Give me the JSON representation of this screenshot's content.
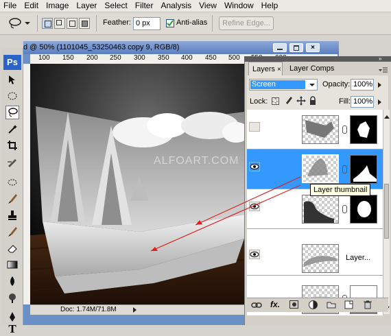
{
  "menu": [
    "File",
    "Edit",
    "Image",
    "Layer",
    "Select",
    "Filter",
    "Analysis",
    "View",
    "Window",
    "Help"
  ],
  "options": {
    "feather_label": "Feather:",
    "feather_value": "0 px",
    "antialias_label": "Anti-alias",
    "refine_edge_label": "Refine Edge..."
  },
  "document": {
    "title": "d @ 50% (1101045_53250463 copy 9, RGB/8)",
    "ruler_ticks": [
      "100",
      "150",
      "200",
      "250",
      "300",
      "350",
      "400",
      "450",
      "500",
      "550",
      "600"
    ],
    "status": "Doc: 1.74M/71.8M",
    "watermark": "ALFOART.COM"
  },
  "toolbox": {
    "logo": "Ps"
  },
  "layers_panel": {
    "tabs": [
      "Layers",
      "Layer Comps"
    ],
    "blend_mode": "Screen",
    "opacity_label": "Opacity:",
    "opacity_value": "100%",
    "lock_label": "Lock:",
    "fill_label": "Fill:",
    "fill_value": "100%",
    "tooltip": "Layer thumbnail",
    "layer3_name": "Layer...",
    "footer_fx": "fx."
  },
  "colors": {
    "selection": "#3399ff",
    "title_blue": "#6b8fc7",
    "arrow_red": "#e02020"
  }
}
